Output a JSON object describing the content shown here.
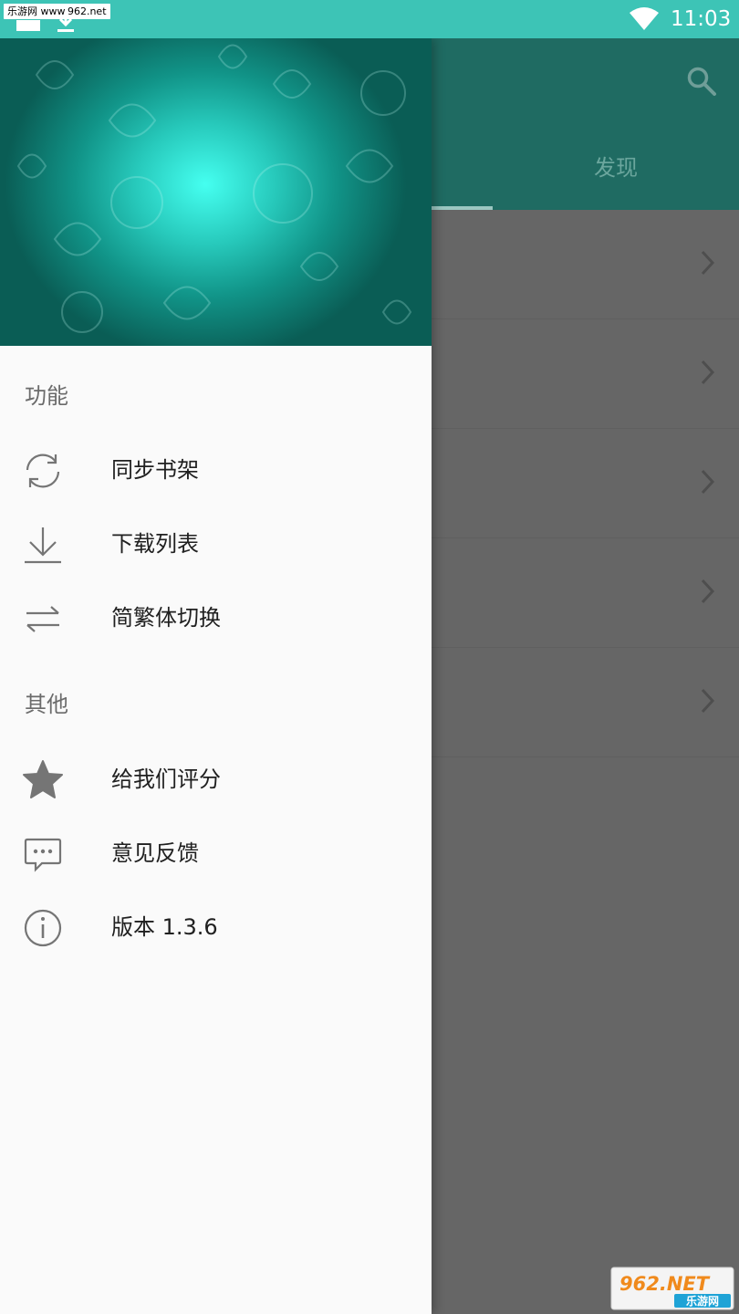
{
  "status_bar": {
    "watermark_text": "乐游网 www.962.net",
    "time": "11:03"
  },
  "app": {
    "tabs": [
      {
        "label": "发现",
        "active": true
      }
    ],
    "list_rows": 5
  },
  "drawer": {
    "sections": [
      {
        "title": "功能",
        "items": [
          {
            "label": "同步书架",
            "icon": "sync-icon"
          },
          {
            "label": "下载列表",
            "icon": "download-icon"
          },
          {
            "label": "简繁体切换",
            "icon": "swap-icon"
          }
        ]
      },
      {
        "title": "其他",
        "items": [
          {
            "label": "给我们评分",
            "icon": "star-icon"
          },
          {
            "label": "意见反馈",
            "icon": "feedback-icon"
          },
          {
            "label": "版本 1.3.6",
            "icon": "info-icon"
          }
        ]
      }
    ]
  },
  "watermark_logo": {
    "top_text": "962.NET",
    "bottom_text": "乐游网"
  },
  "colors": {
    "status_bar": "#3dc4b6",
    "app_header_dimmed": "#1f6b62",
    "drawer_bg": "#fafafa",
    "scrim": "#666666",
    "icon_gray": "#757575"
  }
}
